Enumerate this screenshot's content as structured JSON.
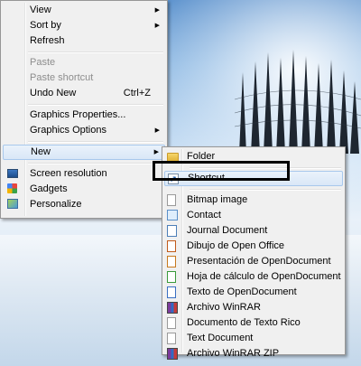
{
  "main_menu": {
    "items": [
      {
        "label": "View",
        "has_submenu": true
      },
      {
        "label": "Sort by",
        "has_submenu": true
      },
      {
        "label": "Refresh"
      },
      {
        "label": "Paste",
        "disabled": true
      },
      {
        "label": "Paste shortcut",
        "disabled": true
      },
      {
        "label": "Undo New",
        "shortcut": "Ctrl+Z"
      },
      {
        "label": "Graphics Properties..."
      },
      {
        "label": "Graphics Options",
        "has_submenu": true
      },
      {
        "label": "New",
        "has_submenu": true,
        "highlighted": true
      },
      {
        "label": "Screen resolution",
        "icon": "monitor-icon"
      },
      {
        "label": "Gadgets",
        "icon": "gadgets-icon"
      },
      {
        "label": "Personalize",
        "icon": "personalize-icon"
      }
    ]
  },
  "new_submenu": {
    "items": [
      {
        "label": "Folder",
        "icon": "folder-icon"
      },
      {
        "label": "Shortcut",
        "icon": "shortcut-icon",
        "highlighted": true
      },
      {
        "label": "Bitmap image",
        "icon": "bitmap-image-icon"
      },
      {
        "label": "Contact",
        "icon": "contact-icon"
      },
      {
        "label": "Journal Document",
        "icon": "journal-document-icon"
      },
      {
        "label": "Dibujo de Open Office",
        "icon": "openoffice-draw-icon"
      },
      {
        "label": "Presentación de OpenDocument",
        "icon": "openoffice-impress-icon"
      },
      {
        "label": "Hoja de cálculo de OpenDocument",
        "icon": "openoffice-calc-icon"
      },
      {
        "label": "Texto de OpenDocument",
        "icon": "openoffice-writer-icon"
      },
      {
        "label": "Archivo WinRAR",
        "icon": "winrar-icon"
      },
      {
        "label": "Documento de Texto Rico",
        "icon": "rich-text-document-icon"
      },
      {
        "label": "Text Document",
        "icon": "text-document-icon"
      },
      {
        "label": "Archivo WinRAR ZIP",
        "icon": "winrar-zip-icon"
      }
    ]
  },
  "symbols": {
    "submenu_arrow": "▶",
    "shortcut_arrow": "↗"
  },
  "colors": {
    "menu_background": "#f0f0f0",
    "highlight_border": "#a8c8ec",
    "disabled_text": "#8d8d8d",
    "annotation_box": "#000000"
  }
}
